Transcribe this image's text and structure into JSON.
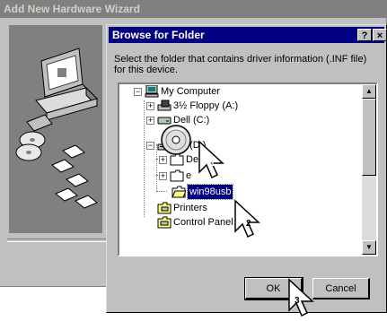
{
  "wizard": {
    "title": "Add New Hardware Wizard"
  },
  "dialog": {
    "title": "Browse for Folder",
    "help_label": "?",
    "close_label": "×",
    "instruction": "Select the folder that contains driver information (.INF file) for this device.",
    "tree": {
      "my_computer": "My Computer",
      "floppy": "3½ Floppy (A:)",
      "dell": "Dell (C:)",
      "hp": "HP (D:)",
      "dell_sub": "Dell",
      "e_sub": "e",
      "win98usb": "win98usb",
      "printers": "Printers",
      "control_panel": "Control Panel"
    },
    "ok_label": "OK",
    "cancel_label": "Cancel"
  },
  "steps": {
    "one": "1",
    "two": "2",
    "three": "3"
  },
  "colors": {
    "title_active": "#000080",
    "title_inactive": "#808080",
    "face": "#c0c0c0",
    "selection": "#000080"
  }
}
